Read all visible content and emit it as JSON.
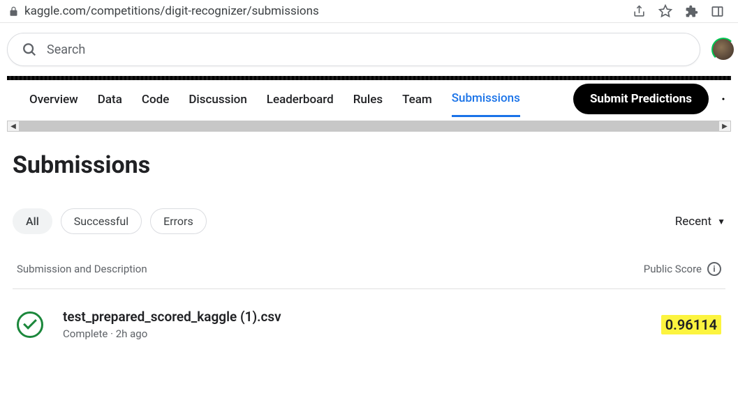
{
  "url": "kaggle.com/competitions/digit-recognizer/submissions",
  "search": {
    "placeholder": "Search"
  },
  "tabs": [
    {
      "label": "Overview"
    },
    {
      "label": "Data"
    },
    {
      "label": "Code"
    },
    {
      "label": "Discussion"
    },
    {
      "label": "Leaderboard"
    },
    {
      "label": "Rules"
    },
    {
      "label": "Team"
    },
    {
      "label": "Submissions",
      "active": true
    }
  ],
  "submit_button": "Submit Predictions",
  "page_title": "Submissions",
  "filters": {
    "chips": [
      {
        "label": "All",
        "selected": true
      },
      {
        "label": "Successful"
      },
      {
        "label": "Errors"
      }
    ],
    "sort_label": "Recent"
  },
  "columns": {
    "left": "Submission and Description",
    "right": "Public Score"
  },
  "submissions": [
    {
      "filename": "test_prepared_scored_kaggle (1).csv",
      "status": "Complete",
      "time": "2h ago",
      "score": "0.96114"
    }
  ]
}
